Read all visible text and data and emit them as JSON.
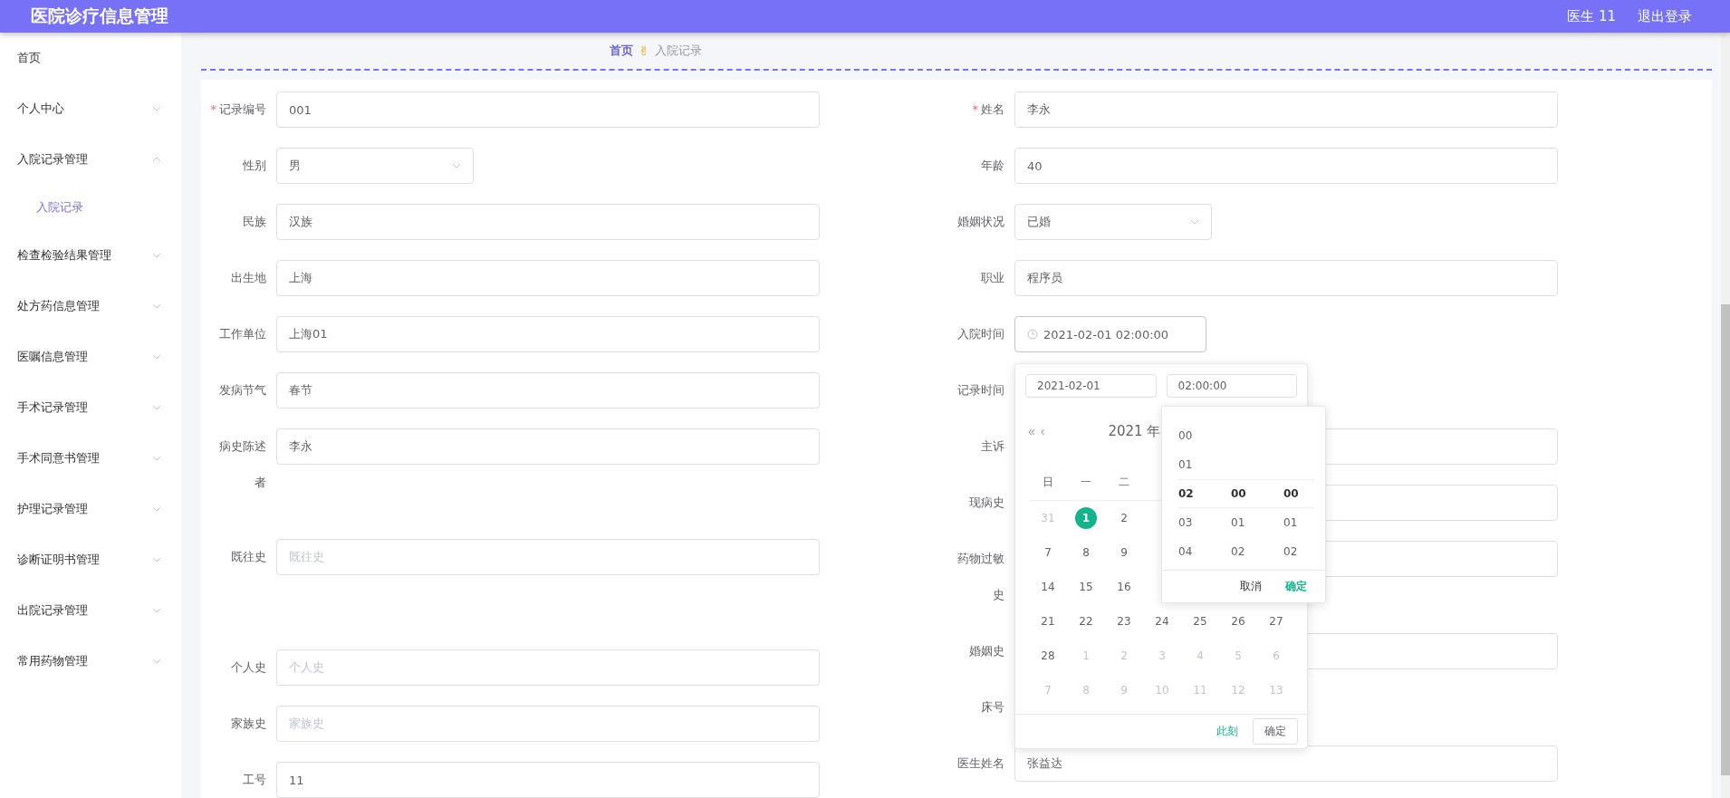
{
  "header": {
    "title": "医院诊疗信息管理",
    "user": "医生 11",
    "logout": "退出登录"
  },
  "sidebar": {
    "items": [
      {
        "label": "首页",
        "expandable": false,
        "selected": false
      },
      {
        "label": "个人中心",
        "expandable": true,
        "expanded": false,
        "selected": false
      },
      {
        "label": "入院记录管理",
        "expandable": true,
        "expanded": true,
        "selected": false,
        "children": [
          {
            "label": "入院记录",
            "selected": true
          }
        ]
      },
      {
        "label": "检查检验结果管理",
        "expandable": true,
        "expanded": false,
        "selected": false
      },
      {
        "label": "处方药信息管理",
        "expandable": true,
        "expanded": false,
        "selected": false
      },
      {
        "label": "医嘱信息管理",
        "expandable": true,
        "expanded": false,
        "selected": false
      },
      {
        "label": "手术记录管理",
        "expandable": true,
        "expanded": false,
        "selected": false
      },
      {
        "label": "手术同意书管理",
        "expandable": true,
        "expanded": false,
        "selected": false
      },
      {
        "label": "护理记录管理",
        "expandable": true,
        "expanded": false,
        "selected": false
      },
      {
        "label": "诊断证明书管理",
        "expandable": true,
        "expanded": false,
        "selected": false
      },
      {
        "label": "出院记录管理",
        "expandable": true,
        "expanded": false,
        "selected": false
      },
      {
        "label": "常用药物管理",
        "expandable": true,
        "expanded": false,
        "selected": false
      }
    ]
  },
  "breadcrumb": {
    "items": [
      "首页",
      "入院记录"
    ],
    "separator": "✌"
  },
  "form": {
    "left": [
      {
        "label": "记录编号",
        "required_mark": "*",
        "kind": "input",
        "value": "001"
      },
      {
        "label": "性别",
        "kind": "select",
        "value": "男"
      },
      {
        "label": "民族",
        "kind": "input",
        "value": "汉族"
      },
      {
        "label": "出生地",
        "kind": "input",
        "value": "上海"
      },
      {
        "label": "工作单位",
        "kind": "input",
        "value": "上海01"
      },
      {
        "label": "发病节气",
        "kind": "input",
        "value": "春节"
      },
      {
        "label": "病史陈述者",
        "kind": "textarea",
        "value": "李永"
      },
      {
        "label": "既往史",
        "kind": "textarea",
        "placeholder": "既往史"
      },
      {
        "label": "个人史",
        "kind": "input",
        "placeholder": "个人史"
      },
      {
        "label": "家族史",
        "kind": "input",
        "placeholder": "家族史"
      },
      {
        "label": "工号",
        "kind": "input",
        "value": "11"
      }
    ],
    "right": [
      {
        "label": "姓名",
        "required_mark": "*",
        "kind": "input",
        "value": "李永"
      },
      {
        "label": "年龄",
        "kind": "input",
        "value": "40"
      },
      {
        "label": "婚姻状况",
        "kind": "select",
        "value": "已婚"
      },
      {
        "label": "职业",
        "kind": "input",
        "value": "程序员"
      },
      {
        "label": "入院时间",
        "kind": "datetime",
        "value": "2021-02-01 02:00:00",
        "open": true
      },
      {
        "label": "记录时间",
        "kind": "hidden"
      },
      {
        "label": "主诉",
        "kind": "input"
      },
      {
        "label": "现病史",
        "kind": "input"
      },
      {
        "label": "药物过敏史",
        "kind": "input"
      },
      {
        "label": "婚姻史",
        "kind": "input"
      },
      {
        "label": "床号",
        "kind": "hidden"
      },
      {
        "label": "医生姓名",
        "kind": "input",
        "value": "张益达"
      }
    ]
  },
  "date_picker": {
    "date": "2021-02-01",
    "time": "02:00:00",
    "prev_year": "«",
    "prev_month": "‹",
    "heading": "2021 年",
    "weekdays": [
      "日",
      "一",
      "二"
    ],
    "weeks": [
      [
        {
          "day": "31",
          "muted": true,
          "selected": false
        },
        {
          "day": "1",
          "muted": false,
          "selected": true
        },
        {
          "day": "2",
          "muted": false,
          "selected": false
        }
      ],
      [
        {
          "day": "7",
          "muted": false,
          "selected": false
        },
        {
          "day": "8",
          "muted": false,
          "selected": false
        },
        {
          "day": "9",
          "muted": false,
          "selected": false
        }
      ],
      [
        {
          "day": "14",
          "muted": false,
          "selected": false
        },
        {
          "day": "15",
          "muted": false,
          "selected": false
        },
        {
          "day": "16",
          "muted": false,
          "selected": false
        }
      ],
      [
        {
          "day": "21",
          "muted": false,
          "selected": false
        },
        {
          "day": "22",
          "muted": false,
          "selected": false
        },
        {
          "day": "23",
          "muted": false,
          "selected": false
        },
        {
          "day": "24",
          "muted": false,
          "selected": false
        },
        {
          "day": "25",
          "muted": false,
          "selected": false
        },
        {
          "day": "26",
          "muted": false,
          "selected": false
        },
        {
          "day": "27",
          "muted": false,
          "selected": false
        }
      ],
      [
        {
          "day": "28",
          "muted": false,
          "selected": false
        },
        {
          "day": "1",
          "muted": true,
          "selected": false
        },
        {
          "day": "2",
          "muted": true,
          "selected": false
        },
        {
          "day": "3",
          "muted": true,
          "selected": false
        },
        {
          "day": "4",
          "muted": true,
          "selected": false
        },
        {
          "day": "5",
          "muted": true,
          "selected": false
        },
        {
          "day": "6",
          "muted": true,
          "selected": false
        }
      ],
      [
        {
          "day": "7",
          "muted": true,
          "selected": false
        },
        {
          "day": "8",
          "muted": true,
          "selected": false
        },
        {
          "day": "9",
          "muted": true,
          "selected": false
        },
        {
          "day": "10",
          "muted": true,
          "selected": false
        },
        {
          "day": "11",
          "muted": true,
          "selected": false
        },
        {
          "day": "12",
          "muted": true,
          "selected": false
        },
        {
          "day": "13",
          "muted": true,
          "selected": false
        }
      ]
    ],
    "now": "此刻",
    "ok": "确定",
    "time_panel": {
      "columns": [
        [
          {
            "text": "00",
            "selected": false
          },
          {
            "text": "01",
            "selected": false
          },
          {
            "text": "02",
            "selected": true
          },
          {
            "text": "03",
            "selected": false
          },
          {
            "text": "04",
            "selected": false
          }
        ],
        [
          {
            "text": "00",
            "selected": true
          },
          {
            "text": "01",
            "selected": false
          },
          {
            "text": "02",
            "selected": false
          }
        ],
        [
          {
            "text": "00",
            "selected": true
          },
          {
            "text": "01",
            "selected": false
          },
          {
            "text": "02",
            "selected": false
          }
        ]
      ],
      "cancel": "取消",
      "ok": "确定"
    }
  }
}
